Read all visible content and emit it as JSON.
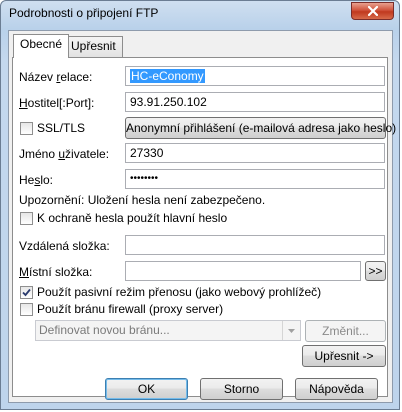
{
  "window": {
    "title": "Podrobnosti o připojení FTP"
  },
  "tabs": [
    {
      "label": "Obecné",
      "active": true
    },
    {
      "label": "Upřesnit",
      "active": false
    }
  ],
  "form": {
    "session_name": {
      "label_pre": "Název ",
      "label_u": "r",
      "label_post": "elace:",
      "value": "HC-eConomy"
    },
    "host": {
      "label_pre": "",
      "label_u": "H",
      "label_post": "ostitel[:Port]:",
      "value": "93.91.250.102"
    },
    "ssl": {
      "label": "SSL/TLS",
      "checked": false
    },
    "anonymous_button": "Anonymní přihlášení (e-mailová adresa jako heslo)",
    "username": {
      "label_pre": "Jméno ",
      "label_u": "u",
      "label_post": "živatele:",
      "value": "27330"
    },
    "password": {
      "label_pre": "He",
      "label_u": "s",
      "label_post": "lo:",
      "value": "••••••••"
    },
    "warning": "Upozornění: Uložení hesla není zabezpečeno.",
    "master_password": {
      "label": "K ochraně hesla použít hlavní heslo",
      "checked": false
    },
    "remote_folder": {
      "label": "Vzdálená složka:",
      "value": ""
    },
    "local_folder": {
      "label_pre": "",
      "label_u": "M",
      "label_post": "ístní složka:",
      "value": "",
      "browse_label": ">>"
    },
    "passive_mode": {
      "label": "Použít pasivní režim přenosu (jako webový prohlížeč)",
      "checked": true
    },
    "firewall": {
      "label": "Použít bránu firewall (proxy server)",
      "checked": false
    },
    "gateway_combo": {
      "value": "Definovat novou bránu..."
    },
    "change_button": "Změnit...",
    "advanced_button": "Upřesnit ->"
  },
  "footer": {
    "ok_label": "OK",
    "cancel_label": "Storno",
    "help_label": "Nápověda"
  },
  "colors": {
    "selection": "#3399ff",
    "title_bg": "#b9d1ea",
    "close": "#c0391f"
  }
}
